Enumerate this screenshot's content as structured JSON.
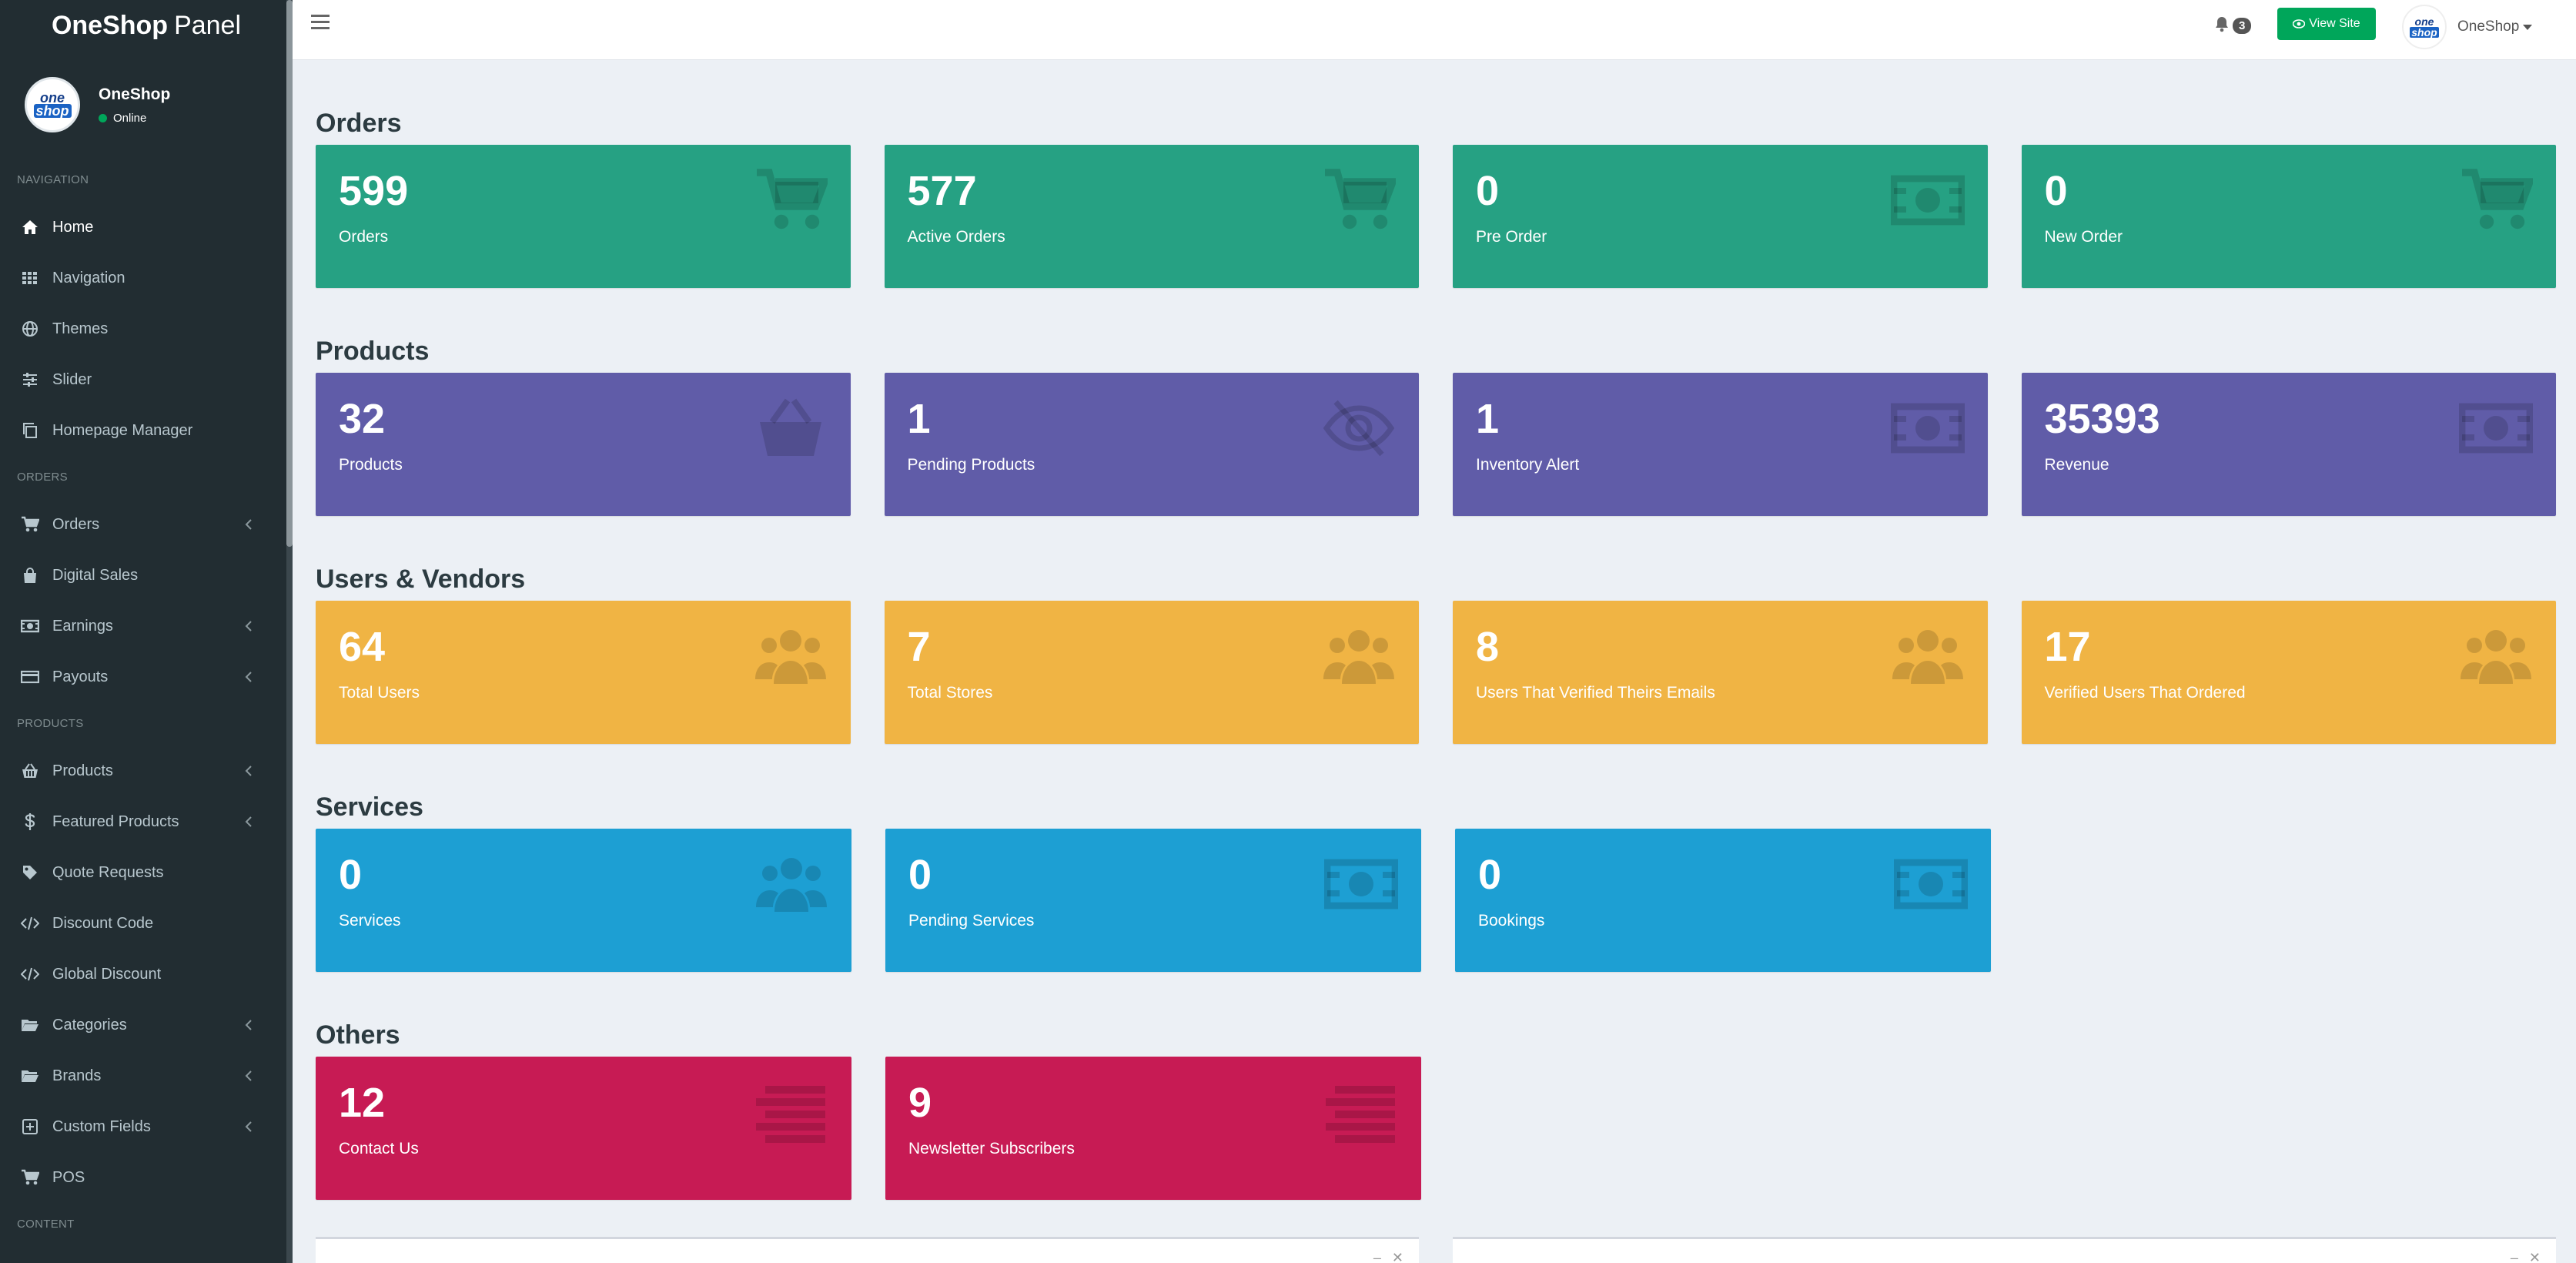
{
  "brand": {
    "bold": "OneShop",
    "thin": "Panel"
  },
  "user": {
    "name": "OneShop",
    "status": "Online",
    "avatar_top": "one",
    "avatar_bottom": "shop"
  },
  "sidebar": {
    "sections": [
      {
        "header": "NAVIGATION",
        "items": [
          {
            "label": "Home",
            "icon": "home-icon",
            "active": true
          },
          {
            "label": "Navigation",
            "icon": "grid-icon"
          },
          {
            "label": "Themes",
            "icon": "globe-icon"
          },
          {
            "label": "Slider",
            "icon": "sliders-icon"
          },
          {
            "label": "Homepage Manager",
            "icon": "copy-icon"
          }
        ]
      },
      {
        "header": "ORDERS",
        "items": [
          {
            "label": "Orders",
            "icon": "cart-icon",
            "chevron": true
          },
          {
            "label": "Digital Sales",
            "icon": "bag-icon"
          },
          {
            "label": "Earnings",
            "icon": "money-icon",
            "chevron": true
          },
          {
            "label": "Payouts",
            "icon": "card-icon",
            "chevron": true
          }
        ]
      },
      {
        "header": "PRODUCTS",
        "items": [
          {
            "label": "Products",
            "icon": "basket-icon",
            "chevron": true
          },
          {
            "label": "Featured Products",
            "icon": "dollar-icon",
            "chevron": true
          },
          {
            "label": "Quote Requests",
            "icon": "tag-icon"
          },
          {
            "label": "Discount Code",
            "icon": "code-icon"
          },
          {
            "label": "Global Discount",
            "icon": "code-icon"
          },
          {
            "label": "Categories",
            "icon": "folder-icon",
            "chevron": true
          },
          {
            "label": "Brands",
            "icon": "folder-icon",
            "chevron": true
          },
          {
            "label": "Custom Fields",
            "icon": "plus-square-icon",
            "chevron": true
          },
          {
            "label": "POS",
            "icon": "cart-icon"
          }
        ]
      },
      {
        "header": "CONTENT",
        "items": []
      }
    ]
  },
  "topbar": {
    "notifications": "3",
    "view_site": "View Site",
    "user_name": "OneShop"
  },
  "dashboard": [
    {
      "title": "Orders",
      "color": "#26a183",
      "cards": [
        {
          "value": "599",
          "label": "Orders",
          "icon": "cart-icon"
        },
        {
          "value": "577",
          "label": "Active Orders",
          "icon": "cart-icon"
        },
        {
          "value": "0",
          "label": "Pre Order",
          "icon": "money-icon"
        },
        {
          "value": "0",
          "label": "New Order",
          "icon": "cart-icon"
        }
      ]
    },
    {
      "title": "Products",
      "color": "#605ca8",
      "cards": [
        {
          "value": "32",
          "label": "Products",
          "icon": "basket-icon"
        },
        {
          "value": "1",
          "label": "Pending Products",
          "icon": "eye-slash-icon"
        },
        {
          "value": "1",
          "label": "Inventory Alert",
          "icon": "money-icon"
        },
        {
          "value": "35393",
          "label": "Revenue",
          "icon": "money-icon"
        }
      ]
    },
    {
      "title": "Users & Vendors",
      "color": "#f0b444",
      "cards": [
        {
          "value": "64",
          "label": "Total Users",
          "icon": "users-icon"
        },
        {
          "value": "7",
          "label": "Total Stores",
          "icon": "users-icon"
        },
        {
          "value": "8",
          "label": "Users That Verified Theirs Emails",
          "icon": "users-icon"
        },
        {
          "value": "17",
          "label": "Verified Users That Ordered",
          "icon": "users-icon"
        }
      ]
    },
    {
      "title": "Services",
      "color": "#1d9fd3",
      "cards": [
        {
          "value": "0",
          "label": "Services",
          "icon": "users-icon"
        },
        {
          "value": "0",
          "label": "Pending Services",
          "icon": "money-icon"
        },
        {
          "value": "0",
          "label": "Bookings",
          "icon": "money-icon"
        }
      ]
    },
    {
      "title": "Others",
      "color": "#c71b54",
      "cards": [
        {
          "value": "12",
          "label": "Contact Us",
          "icon": "list-icon"
        },
        {
          "value": "9",
          "label": "Newsletter Subscribers",
          "icon": "list-icon"
        }
      ]
    }
  ]
}
